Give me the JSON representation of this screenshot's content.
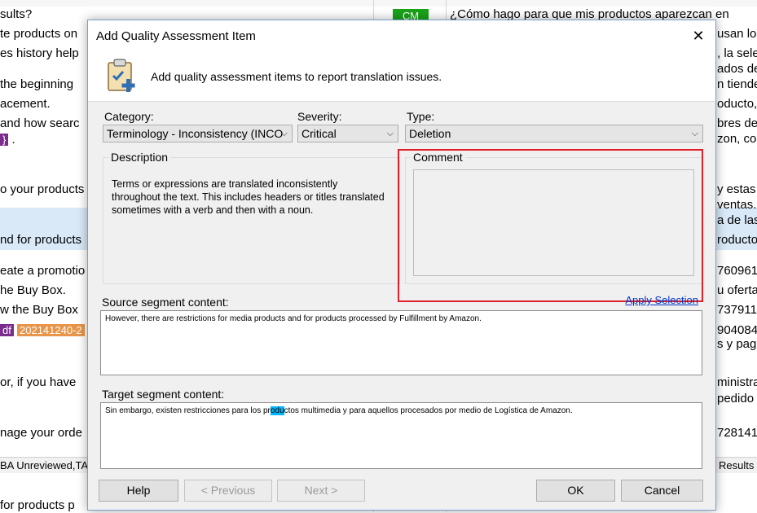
{
  "background": {
    "left_lines": [
      "sults?",
      "te products on",
      "es history help",
      " the beginning",
      "acement.",
      " and how searc",
      "o your products",
      "nd for products",
      "eate a promotio",
      "he Buy Box.",
      "w the Buy Box",
      "or, if you have",
      "nage your orde",
      " for products p"
    ],
    "right_lines": [
      "¿Cómo hago para que mis productos aparezcan en",
      "usan lo",
      ", la sele",
      "ados de",
      "n tiende",
      "oducto, ",
      "bres de",
      "zon, co",
      "y estas",
      "ventas.",
      "a de las",
      "roducto",
      "760961",
      "u oferta",
      "737911",
      "904084",
      "s y pag",
      "ministra",
      " pedido",
      "728141"
    ],
    "badge_cm": "CM",
    "tag_df": "df",
    "tag_id": "202141240-2",
    "tag_left_purple": "}",
    "status_left": "BA Unreviewed,TA",
    "status_right": "Results"
  },
  "dialog": {
    "title": "Add Quality Assessment Item",
    "close_glyph": "✕",
    "header_text": "Add quality assessment items to report translation issues.",
    "category_label": "Category:",
    "category_value": "Terminology - Inconsistency (INCO",
    "severity_label": "Severity:",
    "severity_value": "Critical",
    "type_label": "Type:",
    "type_value": "Deletion",
    "description_label": "Description",
    "description_text": "Terms or expressions are translated inconsistently throughout the text. This includes headers or titles translated sometimes with a verb and then with a noun.",
    "comment_label": "Comment",
    "comment_value": "",
    "apply_selection": "Apply Selection",
    "source_label": "Source segment content:",
    "source_text": "However, there are restrictions for media products and for products processed by Fulfillment by Amazon.",
    "target_label": "Target segment content:",
    "target_before": "Sin embargo, existen restricciones para los pr",
    "target_selected": "odu",
    "target_after": "ctos multimedia y para aquellos procesados por medio de Logística de Amazon.",
    "buttons": {
      "help": "Help",
      "previous": "< Previous",
      "next": "Next >",
      "ok": "OK",
      "cancel": "Cancel"
    }
  },
  "colors": {
    "highlight_border": "#e0202a",
    "link": "#0033cc",
    "badge_green": "#19a319",
    "selection": "#00b7ff"
  }
}
